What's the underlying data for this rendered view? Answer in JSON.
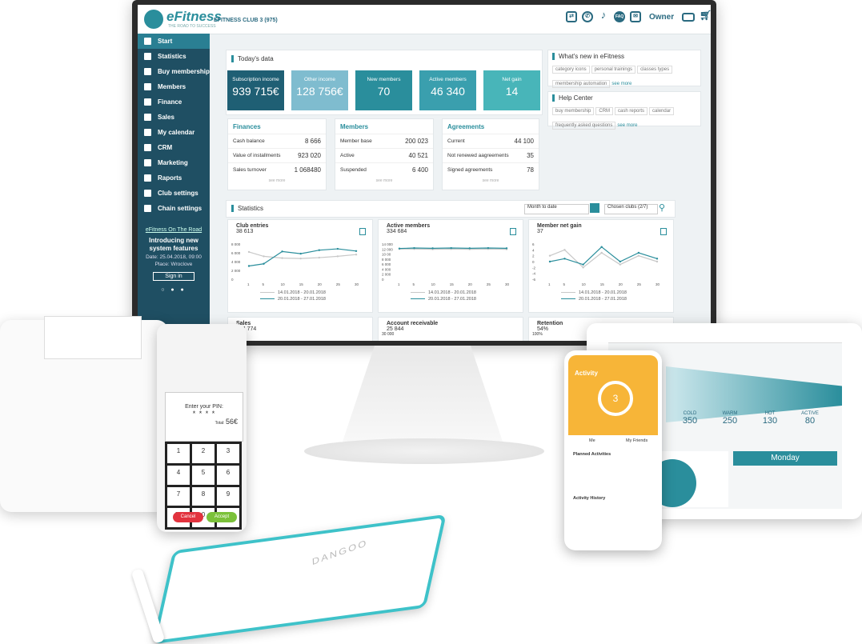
{
  "app": {
    "brand": "eFitness",
    "tagline": "THE ROAD TO SUCCESS",
    "club": "EFITNESS CLUB 3 (975)",
    "user": "Owner",
    "faq": "FAQ"
  },
  "sidebar": {
    "items": [
      {
        "label": "Start",
        "icon": "home-icon"
      },
      {
        "label": "Statistics",
        "icon": "bar-chart-icon"
      },
      {
        "label": "Buy membership",
        "icon": "card-icon"
      },
      {
        "label": "Members",
        "icon": "users-icon"
      },
      {
        "label": "Finance",
        "icon": "finance-icon"
      },
      {
        "label": "Sales",
        "icon": "basket-icon"
      },
      {
        "label": "My calendar",
        "icon": "calendar-icon"
      },
      {
        "label": "CRM",
        "icon": "flag-icon"
      },
      {
        "label": "Marketing",
        "icon": "edit-icon"
      },
      {
        "label": "Raports",
        "icon": "report-icon"
      },
      {
        "label": "Club settings",
        "icon": "gear-icon"
      },
      {
        "label": "Chain settings",
        "icon": "chain-icon"
      }
    ],
    "promo": {
      "heading": "eFitness On The Road",
      "title": "Introducing new system features",
      "date": "Date: 25.04.2018, 09:00",
      "place": "Place: Wroclove",
      "button": "Sign in",
      "dots": "○ ● ●"
    }
  },
  "today": {
    "title": "Today's data",
    "kpis": [
      {
        "label": "Subscription income",
        "value": "939 715€",
        "color": "#1f5f74"
      },
      {
        "label": "Other income",
        "value": "128 756€",
        "color": "#7fbccf"
      },
      {
        "label": "New members",
        "value": "70",
        "color": "#2a8e9c"
      },
      {
        "label": "Active members",
        "value": "46 340",
        "color": "#3a9fae"
      },
      {
        "label": "Net gain",
        "value": "14",
        "color": "#48b5b9"
      }
    ]
  },
  "news": {
    "title": "What's new in eFitness",
    "tags": [
      "category icons",
      "personal trainings",
      "classes types",
      "membership automation"
    ],
    "more": "see more"
  },
  "help": {
    "title": "Help Center",
    "tags": [
      "buy membership",
      "CRM",
      "cash reports",
      "calendar",
      "frequently asked questions"
    ],
    "more": "see more"
  },
  "finances": {
    "title": "Finances",
    "rows": [
      [
        "Cash balance",
        "8 666"
      ],
      [
        "Value of installments",
        "923 020"
      ],
      [
        "Sales turnover",
        "1 068480"
      ]
    ],
    "more": "see more"
  },
  "members": {
    "title": "Members",
    "rows": [
      [
        "Member base",
        "200 023"
      ],
      [
        "Active",
        "40 521"
      ],
      [
        "Suspended",
        "6 400"
      ]
    ],
    "more": "see more"
  },
  "agreements": {
    "title": "Agreements",
    "rows": [
      [
        "Current",
        "44 100"
      ],
      [
        "Not renewed aagreements",
        "35"
      ],
      [
        "Signed agreements",
        "78"
      ]
    ],
    "more": "see more"
  },
  "stats": {
    "title": "Statistics",
    "period": "Month to date",
    "clubs": "Chosen clubs (2/7)",
    "legend_a": "14.01.2018 - 20.01.2018",
    "legend_b": "20.01.2018 - 27.01.2018"
  },
  "chart_data": [
    {
      "type": "line",
      "title": "Club entries",
      "value": "38 613",
      "x": [
        1,
        5,
        10,
        15,
        20,
        25,
        30
      ],
      "yticks": [
        "8 000",
        "6 000",
        "4 000",
        "2 000",
        "0"
      ],
      "ylim": [
        0,
        8000
      ],
      "series": [
        {
          "name": "14.01.2018 - 20.01.2018",
          "color": "#c8c8c8",
          "values": [
            6200,
            5200,
            4800,
            4700,
            4900,
            5200,
            5600
          ]
        },
        {
          "name": "20.01.2018 - 27.01.2018",
          "color": "#2a8e9c",
          "values": [
            3000,
            3500,
            6300,
            5800,
            6600,
            6900,
            6400
          ]
        }
      ]
    },
    {
      "type": "line",
      "title": "Active members",
      "value": "334 684",
      "x": [
        1,
        5,
        10,
        15,
        20,
        25,
        30
      ],
      "yticks": [
        "14 000",
        "12 000",
        "10 00",
        "8 000",
        "6 000",
        "4 000",
        "2 000",
        "0"
      ],
      "ylim": [
        0,
        14000
      ],
      "series": [
        {
          "name": "14.01.2018 - 20.01.2018",
          "color": "#c8c8c8",
          "values": [
            12000,
            12000,
            11900,
            12000,
            11900,
            12000,
            11900
          ]
        },
        {
          "name": "20.01.2018 - 27.01.2018",
          "color": "#2a8e9c",
          "values": [
            12200,
            12400,
            12300,
            12400,
            12300,
            12400,
            12300
          ]
        }
      ]
    },
    {
      "type": "line",
      "title": "Member net gain",
      "value": "37",
      "x": [
        1,
        5,
        10,
        15,
        20,
        25,
        30
      ],
      "yticks": [
        "6",
        "4",
        "2",
        "0",
        "-2",
        "-4",
        "-6"
      ],
      "ylim": [
        -6,
        6
      ],
      "series": [
        {
          "name": "14.01.2018 - 20.01.2018",
          "color": "#c8c8c8",
          "values": [
            2,
            4,
            -2,
            3,
            -1,
            2,
            0
          ]
        },
        {
          "name": "20.01.2018 - 27.01.2018",
          "color": "#2a8e9c",
          "values": [
            0,
            1,
            -1,
            5,
            0,
            3,
            1
          ]
        }
      ]
    }
  ],
  "bottom": [
    {
      "title": "Sales",
      "value": "254 774"
    },
    {
      "title": "Account receivable",
      "value": "25 844",
      "tick": "30 000"
    },
    {
      "title": "Retention",
      "value": "54%",
      "tick": "100%"
    }
  ],
  "terminal": {
    "prompt": "Enter your PIN:",
    "pin": "* * * *",
    "total_label": "Total:",
    "total": "56€",
    "keys": [
      "1",
      "2",
      "3",
      "4",
      "5",
      "6",
      "7",
      "8",
      "9",
      "00",
      "0",
      "<"
    ],
    "cancel": "Cancel",
    "accept": "Accept"
  },
  "tablet": {
    "stages": [
      {
        "label": "COLD",
        "value": "350"
      },
      {
        "label": "WARM",
        "value": "250"
      },
      {
        "label": "HOT",
        "value": "130"
      },
      {
        "label": "ACTIVE",
        "value": "80"
      }
    ],
    "day": "Monday"
  },
  "phone": {
    "title": "Activity",
    "ring": "3",
    "tab_me": "Me",
    "tab_friends": "My Friends",
    "planned": "Planned Activities",
    "history": "Activity History"
  },
  "pad": {
    "brand": "DANGOO"
  }
}
